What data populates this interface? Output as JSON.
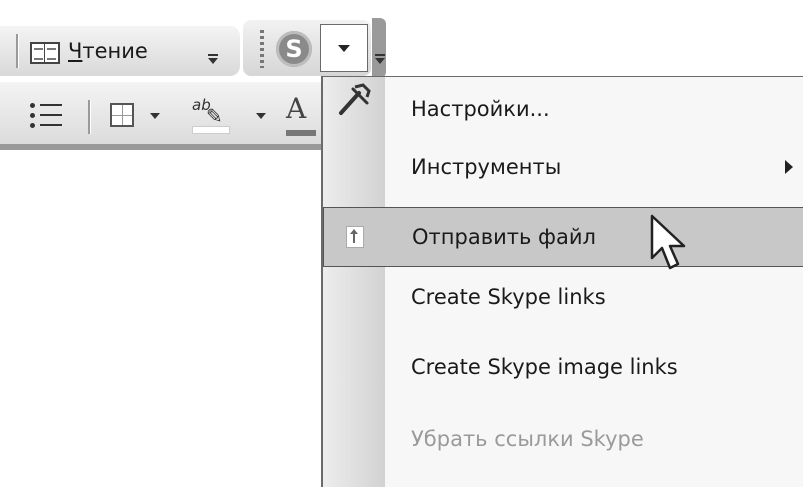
{
  "toolbar": {
    "reading_label_accel": "Ч",
    "reading_label_rest": "тение",
    "skype_letter": "S"
  },
  "format_toolbar": {
    "highlight_glyph": "ab",
    "font_color_glyph": "A"
  },
  "menu": {
    "items": [
      {
        "label": "Настройки...",
        "icon": "tools-icon",
        "state": "normal"
      },
      {
        "label": "Инструменты",
        "icon": "",
        "state": "normal",
        "submenu": true
      },
      {
        "label": "Отправить файл",
        "icon": "upload-file-icon",
        "state": "highlighted"
      },
      {
        "label": "Create Skype links",
        "icon": "",
        "state": "normal"
      },
      {
        "label": "Create Skype image links",
        "icon": "",
        "state": "normal"
      },
      {
        "label": "Убрать ссылки Skype",
        "icon": "",
        "state": "disabled"
      }
    ]
  },
  "colors": {
    "highlight_bg": "#c8c8c8",
    "menu_bg": "#f7f7f7",
    "disabled_text": "#9a9a9a"
  }
}
